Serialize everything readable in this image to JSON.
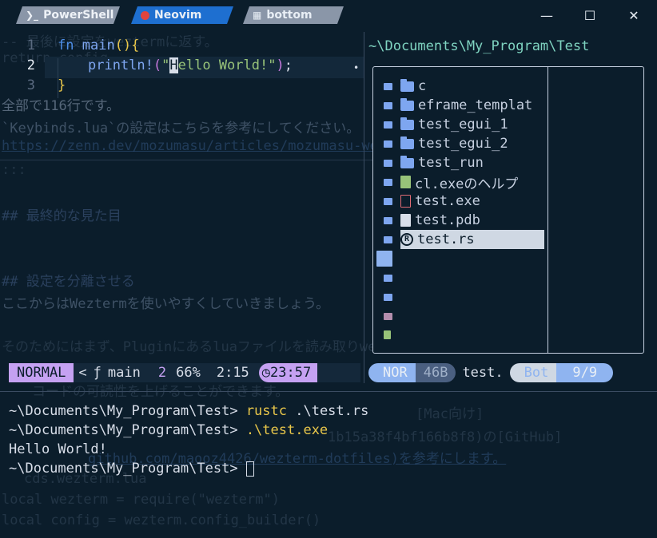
{
  "tabs": [
    {
      "label": "PowerShell",
      "icon": "powershell-icon"
    },
    {
      "label": "Neovim",
      "icon": "neovim-icon"
    },
    {
      "label": "bottom",
      "icon": "bottom-icon"
    }
  ],
  "window_controls": {
    "minimize": "—",
    "maximize": "☐",
    "close": "✕"
  },
  "editor": {
    "line_numbers": [
      "1",
      "2",
      "3"
    ],
    "line1": {
      "kw": "fn",
      "name": "main",
      "parens": "()",
      "brace": "{"
    },
    "line2": {
      "macro": "println!",
      "open": "(",
      "q": "\"",
      "cursor_char": "H",
      "rest": "ello World!\"",
      "close": ")",
      "semi": ";"
    },
    "line3": {
      "brace": "}"
    },
    "modified_marker": "•"
  },
  "explorer": {
    "title": "~\\Documents\\My_Program\\Test",
    "items": [
      {
        "label": "c",
        "type": "folder"
      },
      {
        "label": "eframe_templat",
        "type": "folder"
      },
      {
        "label": "test_egui_1",
        "type": "folder"
      },
      {
        "label": "test_egui_2",
        "type": "folder"
      },
      {
        "label": "test_run",
        "type": "folder"
      },
      {
        "label": "cl.exeのヘルプ",
        "type": "file-green"
      },
      {
        "label": "test.exe",
        "type": "file-red"
      },
      {
        "label": "test.pdb",
        "type": "file"
      },
      {
        "label": "test.rs",
        "type": "rust",
        "selected": true
      }
    ]
  },
  "statusline_left": {
    "mode": "NORMAL",
    "arrow": "<",
    "func_icon": "ƒ",
    "func": "main",
    "line": "2",
    "percent": "66%",
    "position": "2:15",
    "clock_icon": "◷",
    "time": "23:57"
  },
  "statusline_right": {
    "mode": "NOR",
    "size": "46B",
    "file": "test.",
    "scroll": "Bot",
    "position": "9/9"
  },
  "terminal": {
    "lines": [
      {
        "prompt": "~\\Documents\\My_Program\\Test> ",
        "cmd": "rustc",
        "arg": " .\\test.rs"
      },
      {
        "prompt": "~\\Documents\\My_Program\\Test> ",
        "cmd": ".\\test.exe",
        "arg": ""
      },
      {
        "prompt": "Hello World!",
        "cmd": "",
        "arg": ""
      },
      {
        "prompt": "~\\Documents\\My_Program\\Test> ",
        "cmd": "",
        "arg": ""
      }
    ]
  },
  "ghost_text": [
    "-- 最後に設定をweztermに返す。",
    "return config",
    "全部で116行です。",
    "`Keybinds.lua`の設定はこちらを参考にしてください。",
    "https://zenn.dev/mozumasu/articles/mozumasu-wezterm-customization",
    ":::",
    "## 最終的な見た目",
    "## 設定を分離させる",
    "ここからはWeztermを使いやすくしていきましょう。",
    "そのためにはまず、Pluginにあるluaファイルを読み取りwezterm.luaを作成し",
    "コードの可読性を上げることができます。",
    "[Mac向け]",
    "1b15a38f4bf166b8f8)の[GitHub]",
    "github.com/maooz4426/wezterm-dotfiles)を参考にします。",
    "cds.wezterm.lua",
    "local wezterm = require(\"wezterm\")",
    "local config = wezterm.config_builder()"
  ]
}
